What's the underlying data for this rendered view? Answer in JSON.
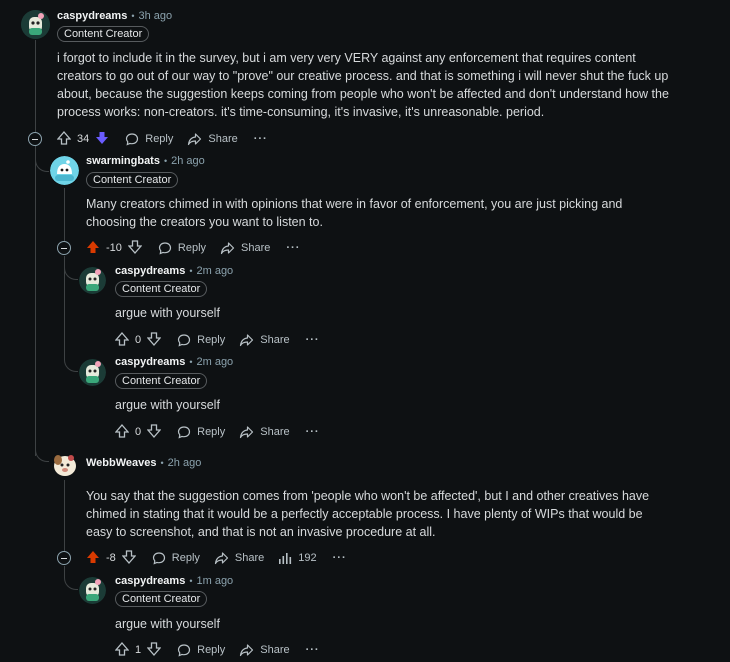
{
  "comments": [
    {
      "username": "caspydreams",
      "time": "3h ago",
      "flair": "Content Creator",
      "body": "i forgot to include it in the survey, but i am very very VERY against any enforcement that requires content creators to go out of our way to \"prove\" our creative process. and that is something i will never shut the fuck up about, because the suggestion keeps coming from people who won't be affected and don't understand how the process works: non-creators. it's time-consuming, it's invasive, it's unreasonable. period.",
      "score": "34",
      "vote": "downvoted",
      "reply_label": "Reply",
      "share_label": "Share",
      "more_label": "···"
    },
    {
      "username": "swarmingbats",
      "time": "2h ago",
      "flair": "Content Creator",
      "body": "Many creators chimed in with opinions that were in favor of enforcement, you are just picking and choosing the creators you want to listen to.",
      "score": "-10",
      "vote": "upvoted",
      "reply_label": "Reply",
      "share_label": "Share",
      "more_label": "···"
    },
    {
      "username": "caspydreams",
      "time": "2m ago",
      "flair": "Content Creator",
      "body": "argue with yourself",
      "score": "0",
      "reply_label": "Reply",
      "share_label": "Share",
      "more_label": "···"
    },
    {
      "username": "caspydreams",
      "time": "2m ago",
      "flair": "Content Creator",
      "body": "argue with yourself",
      "score": "0",
      "reply_label": "Reply",
      "share_label": "Share",
      "more_label": "···"
    },
    {
      "username": "WebbWeaves",
      "time": "2h ago",
      "body": "You say that the suggestion comes from 'people who won't be affected', but I and other creatives have chimed in stating that it would be a perfectly acceptable process. I have plenty of WIPs that would be easy to screenshot, and that is not an invasive procedure at all.",
      "score": "-8",
      "vote": "upvoted",
      "reply_label": "Reply",
      "share_label": "Share",
      "views": "192",
      "more_label": "···"
    },
    {
      "username": "caspydreams",
      "time": "1m ago",
      "flair": "Content Creator",
      "body": "argue with yourself",
      "score": "1",
      "reply_label": "Reply",
      "share_label": "Share",
      "more_label": "···"
    }
  ],
  "separator": "•",
  "colors": {
    "background": "#0e1113",
    "upvote_active": "#d93a00",
    "downvote_active": "#6a5cff",
    "thread_line": "#3e4244"
  },
  "icons": [
    "upvote-icon",
    "downvote-icon",
    "reply-icon",
    "share-icon",
    "views-icon",
    "collapse-icon"
  ]
}
